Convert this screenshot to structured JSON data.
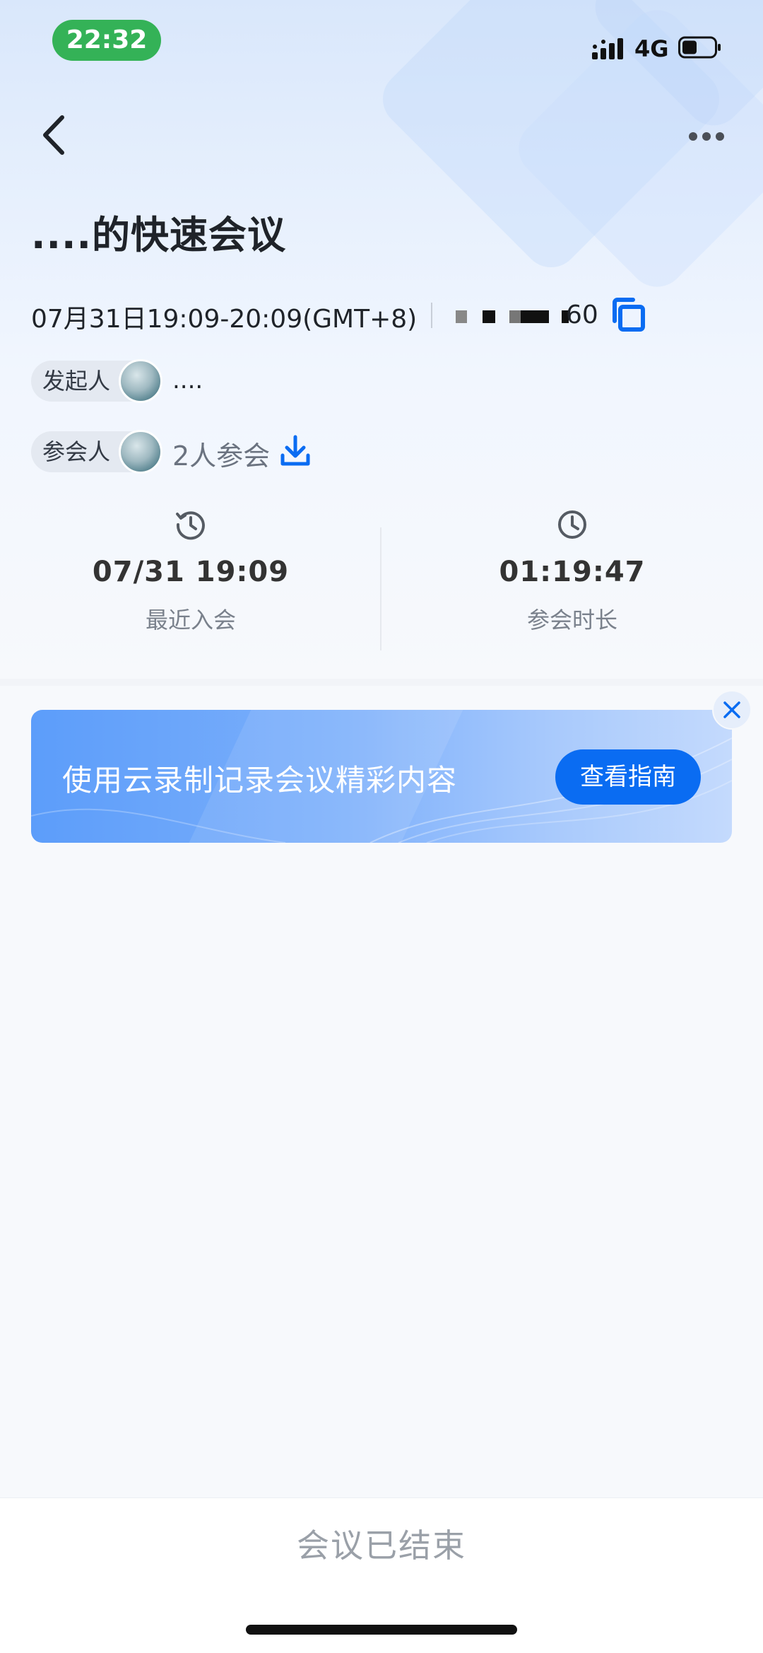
{
  "status_bar": {
    "time": "22:32",
    "network": "4G"
  },
  "header": {
    "title": "....的快速会议"
  },
  "meeting": {
    "time_range": "07月31日19:09-20:09(GMT+8)",
    "id_visible_tail": "60"
  },
  "organizer": {
    "label": "发起人",
    "name": "...."
  },
  "attendees": {
    "label": "参会人",
    "count_text": "2人参会"
  },
  "stats": {
    "last_join_value": "07/31 19:09",
    "last_join_label": "最近入会",
    "duration_value": "01:19:47",
    "duration_label": "参会时长"
  },
  "banner": {
    "text": "使用云录制记录会议精彩内容",
    "button_label": "查看指南"
  },
  "footer": {
    "status_text": "会议已结束"
  },
  "colors": {
    "accent": "#0a6cf2",
    "status_pill": "#34b257"
  },
  "icons": {
    "back": "chevron-left-icon",
    "more": "more-horizontal-icon",
    "copy": "copy-icon",
    "download": "download-icon",
    "history": "history-clock-icon",
    "clock": "clock-icon",
    "close": "close-icon"
  }
}
